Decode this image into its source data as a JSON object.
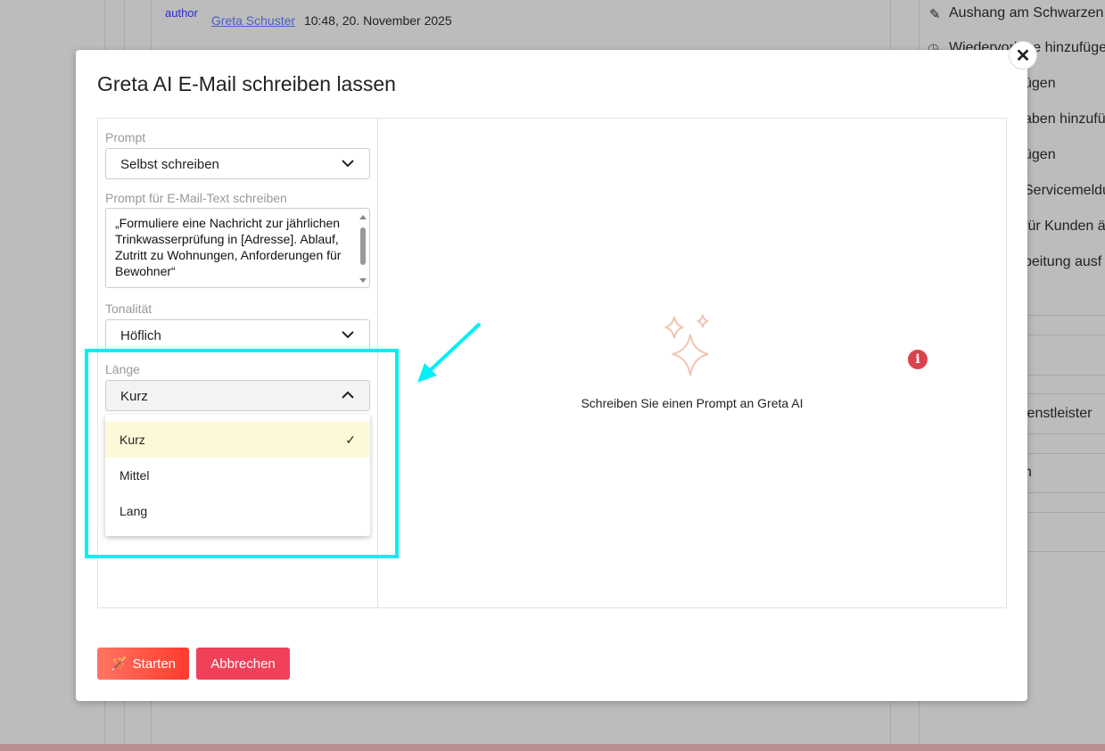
{
  "background": {
    "author_img_alt": "author",
    "author_name": "Greta Schuster",
    "timestamp": "10:48, 20. November 2025",
    "right_items": [
      "Aushang am Schwarzen",
      "Wiedervorlage hinzufügen",
      "ügen",
      "aben hinzufü",
      "ügen",
      "Servicemeldu",
      "für Kunden ä",
      "beitung ausf",
      "ienstleister",
      "n"
    ]
  },
  "modal": {
    "title": "Greta AI E-Mail schreiben lassen",
    "close_label": "✕",
    "prompt_label": "Prompt",
    "prompt_value": "Selbst schreiben",
    "prompt_text_label": "Prompt für E-Mail-Text schreiben",
    "prompt_text_value": "„Formuliere eine Nachricht zur jährlichen Trinkwasserprüfung in [Adresse]. Ablauf, Zutritt zu Wohnungen, Anforderungen für Bewohner“",
    "tone_label": "Tonalität",
    "tone_value": "Höflich",
    "length_label": "Länge",
    "length_value": "Kurz",
    "length_options": [
      "Kurz",
      "Mittel",
      "Lang"
    ],
    "empty_text": "Schreiben Sie einen Prompt an Greta AI",
    "start_label": "Starten",
    "cancel_label": "Abbrechen"
  },
  "colors": {
    "highlight": "#00f0f5",
    "start": "#ff4b3a",
    "cancel": "#f1405a",
    "selected_option": "#fdf9d8"
  }
}
